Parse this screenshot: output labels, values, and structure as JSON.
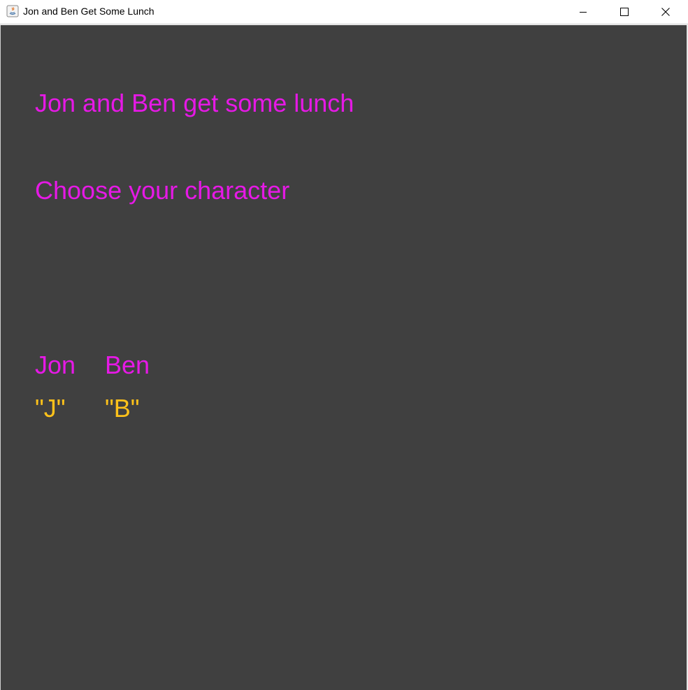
{
  "window": {
    "title": "Jon and Ben Get Some Lunch",
    "controls": {
      "minimize_icon": "minimize-icon",
      "maximize_icon": "maximize-icon",
      "close_icon": "close-icon"
    }
  },
  "game": {
    "title": "Jon and Ben get some lunch",
    "prompt": "Choose your character",
    "characters": [
      {
        "name": "Jon",
        "key": "\"J\""
      },
      {
        "name": "Ben",
        "key": "\"B\""
      }
    ]
  },
  "colors": {
    "background": "#404040",
    "heading_text": "#e619e6",
    "key_text": "#ffc21a"
  }
}
